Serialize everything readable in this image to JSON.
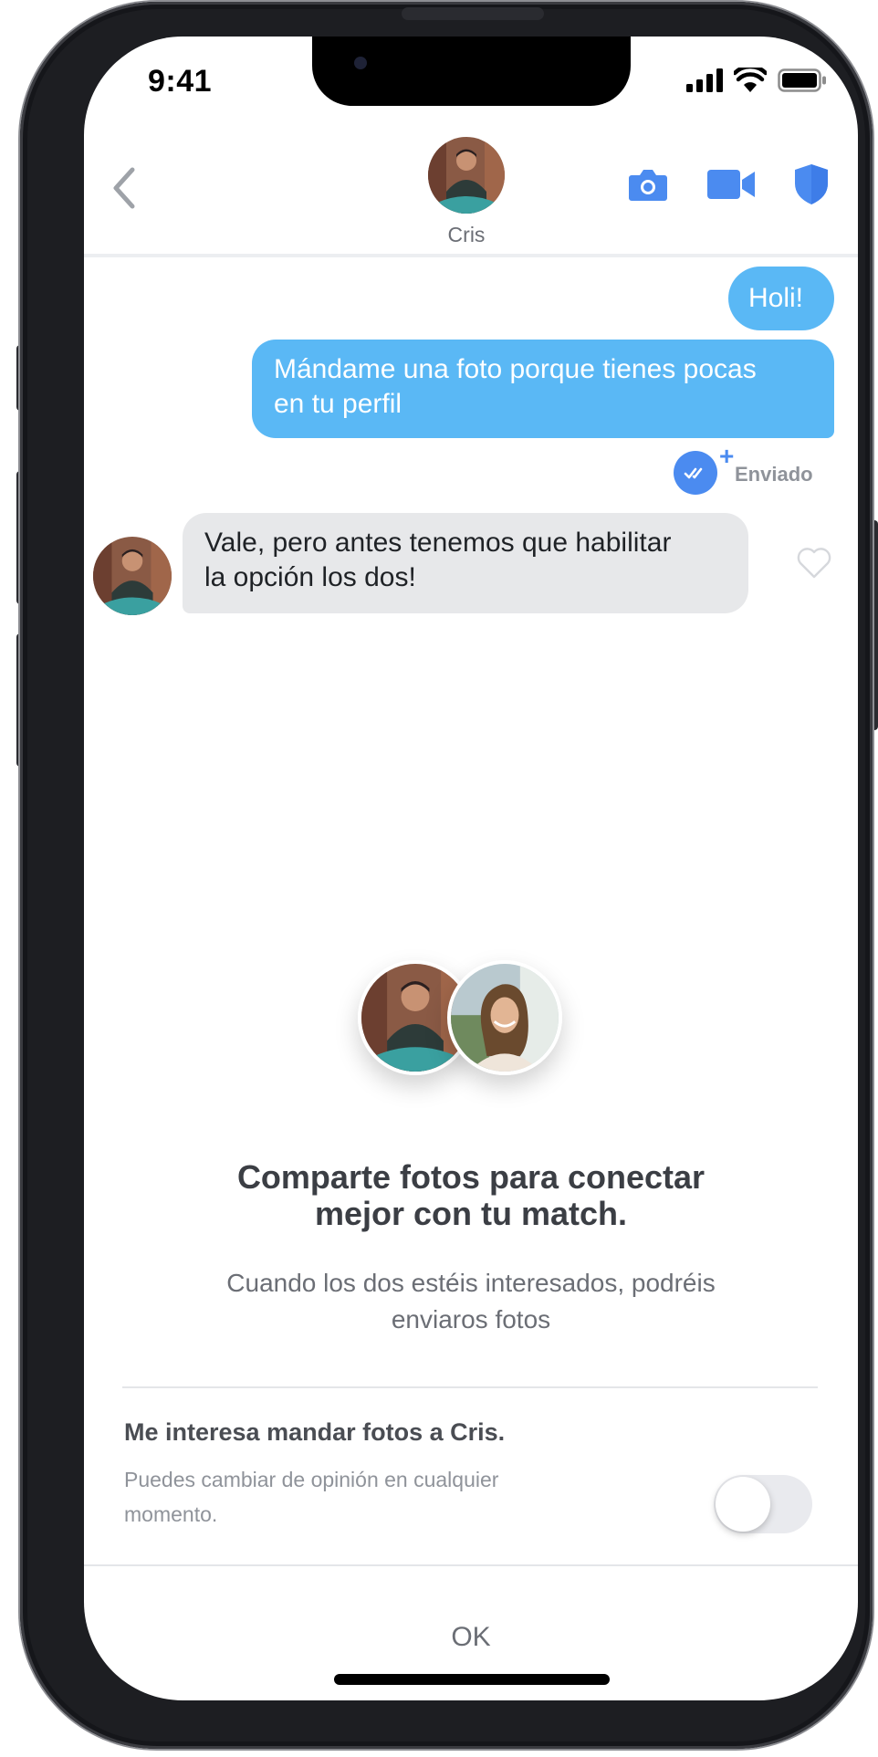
{
  "status_bar": {
    "time": "9:41"
  },
  "header": {
    "contact_name": "Cris",
    "back_icon": "chevron-left-icon",
    "actions": [
      "camera-icon",
      "video-icon",
      "shield-icon"
    ],
    "accent": "#4b8bf0"
  },
  "messages": [
    {
      "direction": "outgoing",
      "text": "Holi!"
    },
    {
      "direction": "outgoing",
      "text": "Mándame una foto porque tienes pocas en tu perfil",
      "lines": [
        "Mándame una foto porque tienes pocas",
        "en tu perfil"
      ]
    },
    {
      "direction": "incoming",
      "text": "Vale, pero antes tenemos que habilitar la opción los dos!",
      "lines": [
        "Vale, pero antes tenemos que habilitar",
        "la opción los dos!"
      ]
    }
  ],
  "delivery": {
    "status": "Enviado",
    "plus": "+"
  },
  "sheet": {
    "title_line1": "Comparte fotos para conectar",
    "title_line2": "mejor con tu match.",
    "subtitle_line1": "Cuando los dos estéis interesados, podréis",
    "subtitle_line2": "enviaros fotos",
    "option_title": "Me interesa mandar fotos a Cris.",
    "option_desc_line1": "Puedes cambiar de opinión en cualquier",
    "option_desc_line2": "momento.",
    "toggle_on": false,
    "ok_label": "OK"
  },
  "colors": {
    "outgoing_bubble": "#5ab8f5",
    "incoming_bubble": "#e7e8ea",
    "read_badge": "#4b8bf0"
  }
}
